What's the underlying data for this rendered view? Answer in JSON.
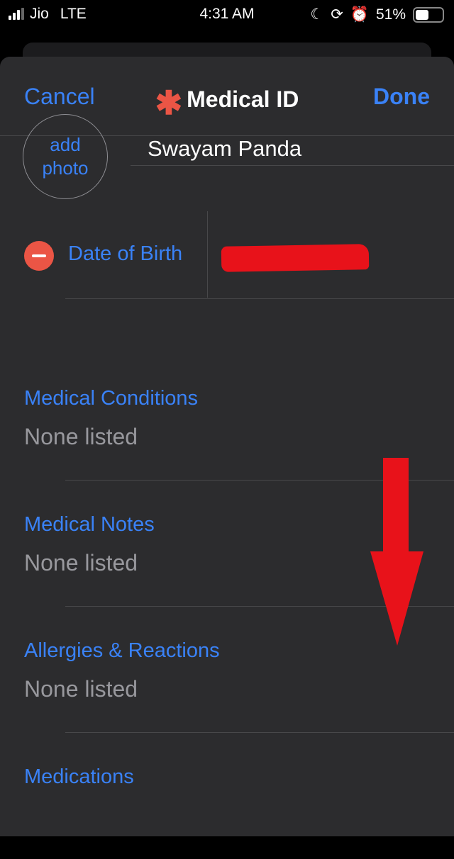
{
  "status_bar": {
    "carrier": "Jio",
    "network": "LTE",
    "time": "4:31 AM",
    "battery": "51%",
    "battery_level": 0.51,
    "icons": [
      "signal-icon",
      "moon-icon",
      "rotation-lock-icon",
      "alarm-icon",
      "battery-icon"
    ]
  },
  "nav": {
    "cancel": "Cancel",
    "title": "Medical ID",
    "title_icon": "✱",
    "done": "Done"
  },
  "profile": {
    "add_photo": "add photo",
    "name": "Swayam Panda"
  },
  "dob": {
    "label": "Date of Birth",
    "value": ""
  },
  "sections": [
    {
      "label": "Medical Conditions",
      "value": "None listed"
    },
    {
      "label": "Medical Notes",
      "value": "None listed"
    },
    {
      "label": "Allergies & Reactions",
      "value": "None listed"
    },
    {
      "label": "Medications",
      "value": ""
    }
  ],
  "colors": {
    "accent": "#3a82f7",
    "destructive": "#eb5545",
    "annotation_arrow": "#e8121a"
  }
}
